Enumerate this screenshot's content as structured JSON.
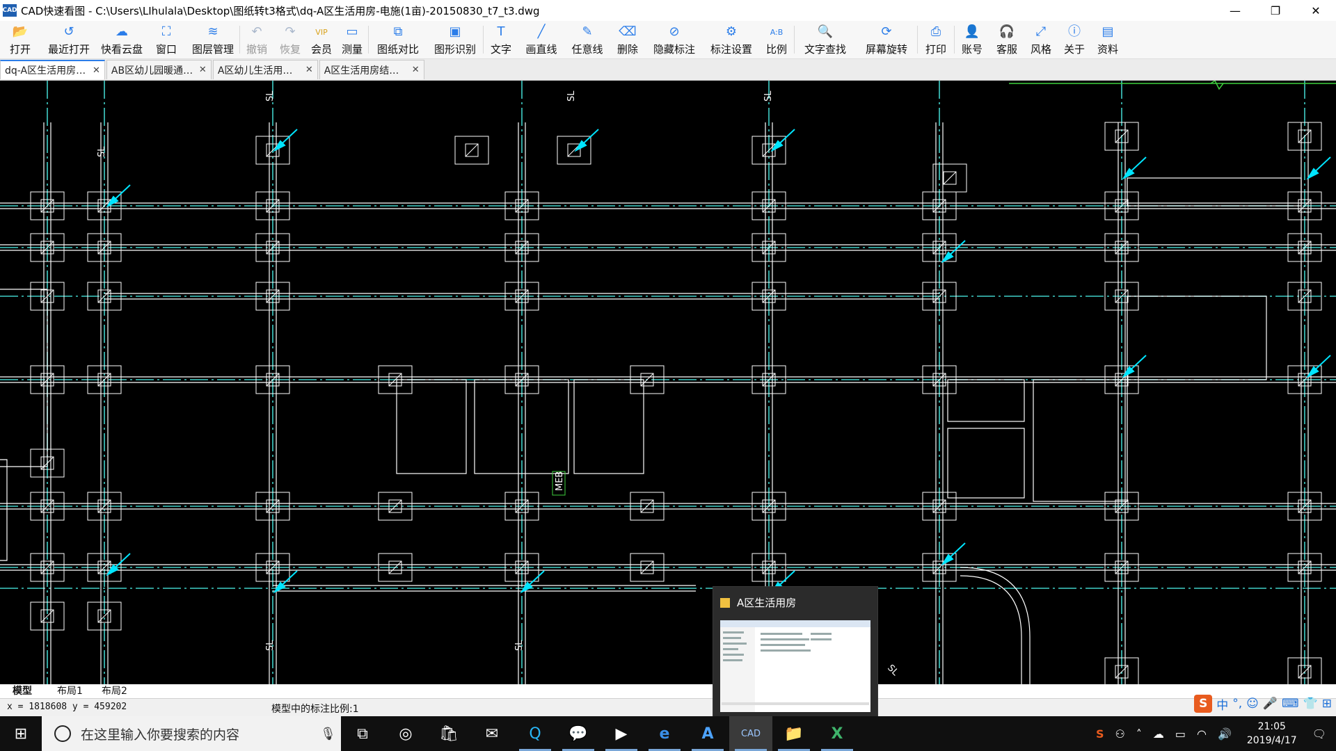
{
  "app": {
    "icon_text": "CAD",
    "title": "CAD快速看图 - C:\\Users\\LIhulala\\Desktop\\图纸转t3格式\\dq-A区生活用房-电施(1亩)-20150830_t7_t3.dwg"
  },
  "window_controls": {
    "minimize": "—",
    "restore": "❐",
    "close": "✕"
  },
  "toolbar": [
    {
      "label": "打开",
      "icon": "folder-open-icon",
      "glyph": "📂",
      "enabled": true
    },
    {
      "label": "最近打开",
      "icon": "history-icon",
      "glyph": "↺",
      "enabled": true
    },
    {
      "label": "快看云盘",
      "icon": "cloud-icon",
      "glyph": "☁",
      "enabled": true
    },
    {
      "label": "窗口",
      "icon": "window-icon",
      "glyph": "⛶",
      "enabled": true
    },
    {
      "label": "图层管理",
      "icon": "layers-icon",
      "glyph": "≋",
      "enabled": true
    },
    {
      "label": "撤销",
      "icon": "undo-icon",
      "glyph": "↶",
      "enabled": false
    },
    {
      "label": "恢复",
      "icon": "redo-icon",
      "glyph": "↷",
      "enabled": false
    },
    {
      "label": "会员",
      "icon": "vip-icon",
      "glyph": "VIP",
      "enabled": true,
      "vip": true
    },
    {
      "label": "测量",
      "icon": "ruler-icon",
      "glyph": "▭",
      "enabled": true
    },
    {
      "label": "图纸对比",
      "icon": "compare-icon",
      "glyph": "⧉",
      "enabled": true
    },
    {
      "label": "图形识别",
      "icon": "shape-recognition-icon",
      "glyph": "▣",
      "enabled": true
    },
    {
      "label": "文字",
      "icon": "text-icon",
      "glyph": "T",
      "enabled": true
    },
    {
      "label": "画直线",
      "icon": "line-icon",
      "glyph": "╱",
      "enabled": true
    },
    {
      "label": "任意线",
      "icon": "pencil-icon",
      "glyph": "✎",
      "enabled": true
    },
    {
      "label": "删除",
      "icon": "eraser-icon",
      "glyph": "⌫",
      "enabled": true
    },
    {
      "label": "隐藏标注",
      "icon": "hide-annotation-icon",
      "glyph": "⊘",
      "enabled": true
    },
    {
      "label": "标注设置",
      "icon": "annotation-settings-icon",
      "glyph": "⚙",
      "enabled": true
    },
    {
      "label": "比例",
      "icon": "scale-icon",
      "glyph": "A:B",
      "enabled": true
    },
    {
      "label": "文字查找",
      "icon": "text-search-icon",
      "glyph": "🔍",
      "enabled": true
    },
    {
      "label": "屏幕旋转",
      "icon": "rotate-screen-icon",
      "glyph": "⟳",
      "enabled": true
    },
    {
      "label": "打印",
      "icon": "printer-icon",
      "glyph": "⎙",
      "enabled": true
    },
    {
      "label": "账号",
      "icon": "user-icon",
      "glyph": "👤",
      "enabled": true
    },
    {
      "label": "客服",
      "icon": "headset-icon",
      "glyph": "🎧",
      "enabled": true
    },
    {
      "label": "风格",
      "icon": "style-icon",
      "glyph": "⤢",
      "enabled": true
    },
    {
      "label": "关于",
      "icon": "info-icon",
      "glyph": "ⓘ",
      "enabled": true
    },
    {
      "label": "资料",
      "icon": "documents-icon",
      "glyph": "▤",
      "enabled": true
    }
  ],
  "doc_tabs": [
    {
      "label": "dq-A区生活用房…",
      "active": true
    },
    {
      "label": "AB区幼儿园暖通…",
      "active": false
    },
    {
      "label": "A区幼儿生活用…",
      "active": false
    },
    {
      "label": "A区生活用房结…",
      "active": false
    }
  ],
  "drawing": {
    "labels": [
      "SL",
      "SL",
      "SL",
      "SL",
      "SL",
      "SL",
      "MEB",
      "SL"
    ],
    "colors": {
      "background": "#000000",
      "wall": "#ffffff",
      "axis": "#40d0c8",
      "marker": "#00e5ff",
      "green": "#3ecf3e"
    }
  },
  "layout_tabs": [
    {
      "label": "模型",
      "active": true
    },
    {
      "label": "布局1",
      "active": false
    },
    {
      "label": "布局2",
      "active": false
    }
  ],
  "status": {
    "coords": "x = 1818608  y = 459202",
    "scale_text": "模型中的标注比例:1"
  },
  "ime": {
    "items": [
      "S",
      "中",
      "°,",
      "☺",
      "🎤",
      "⌨",
      "👕",
      "⊞"
    ]
  },
  "taskbar": {
    "search_placeholder": "在这里输入你要搜索的内容",
    "apps": [
      {
        "name": "task-view-icon",
        "glyph": "⧉"
      },
      {
        "name": "browser-icon",
        "glyph": "◎"
      },
      {
        "name": "store-icon",
        "glyph": "🛍"
      },
      {
        "name": "mail-icon",
        "glyph": "✉"
      },
      {
        "name": "qq-icon",
        "glyph": "Q"
      },
      {
        "name": "wechat-icon",
        "glyph": "💬"
      },
      {
        "name": "iqiyi-icon",
        "glyph": "▶"
      },
      {
        "name": "edge-icon",
        "glyph": "e"
      },
      {
        "name": "a-app-icon",
        "glyph": "A"
      },
      {
        "name": "cad-app-icon",
        "glyph": "CAD"
      },
      {
        "name": "file-explorer-icon",
        "glyph": "📁"
      },
      {
        "name": "excel-icon",
        "glyph": "X"
      }
    ],
    "clock_time": "21:05",
    "clock_date": "2019/4/17"
  },
  "preview": {
    "title": "A区生活用房"
  }
}
